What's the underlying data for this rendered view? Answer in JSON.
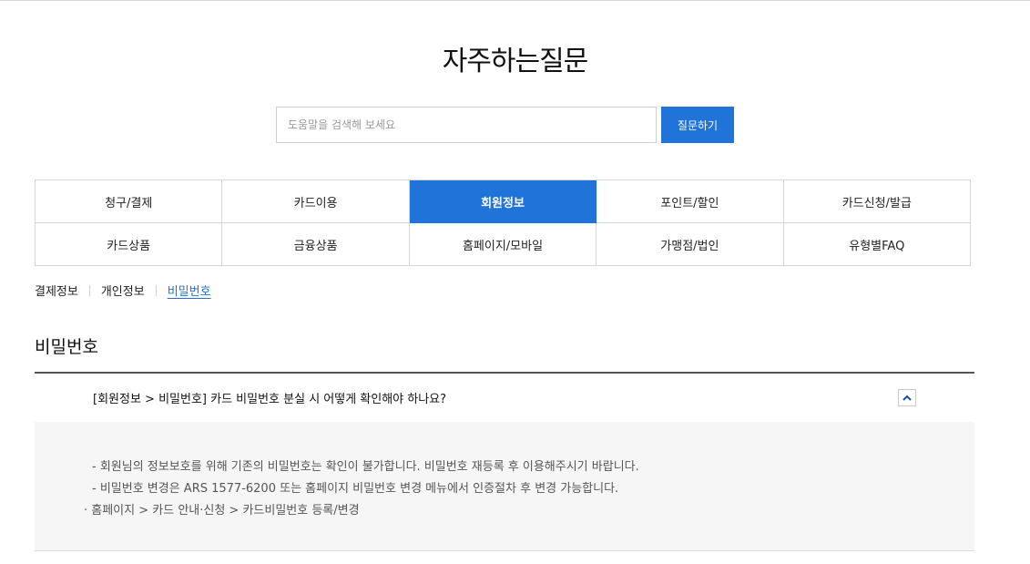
{
  "page": {
    "title": "자주하는질문"
  },
  "search": {
    "placeholder": "도움말을 검색해 보세요",
    "button_label": "질문하기"
  },
  "categories": {
    "active_index": 2,
    "items": [
      {
        "label": "청구/결제"
      },
      {
        "label": "카드이용"
      },
      {
        "label": "회원정보"
      },
      {
        "label": "포인트/할인"
      },
      {
        "label": "카드신청/발급"
      },
      {
        "label": "카드상품"
      },
      {
        "label": "금융상품"
      },
      {
        "label": "홈페이지/모바일"
      },
      {
        "label": "가맹점/법인"
      },
      {
        "label": "유형별FAQ"
      }
    ]
  },
  "sub_tabs": {
    "items": [
      {
        "label": "결제정보"
      },
      {
        "label": "개인정보"
      },
      {
        "label": "비밀번호"
      }
    ],
    "active_index": 2
  },
  "section": {
    "title": "비밀번호"
  },
  "faq": {
    "question": "[회원정보 > 비밀번호] 카드 비밀번호 분실 시 어떻게 확인해야 하나요?",
    "expanded": true,
    "toggle_icon": "chevron-up-icon",
    "answer_lines": [
      "- 회원님의 정보보호를 위해 기존의 비밀번호는 확인이 불가합니다. 비밀번호 재등록 후 이용해주시기 바랍니다.",
      "- 비밀번호 변경은 ARS 1577-6200 또는 홈페이지 비밀번호 변경 메뉴에서 인증절차 후 변경 가능합니다.",
      "· 홈페이지 > 카드 안내·신청 > 카드비밀번호 등록/변경"
    ]
  },
  "colors": {
    "accent": "#1f73d9",
    "answer_bg": "#f6f6f6",
    "border": "#d6d6d6"
  }
}
